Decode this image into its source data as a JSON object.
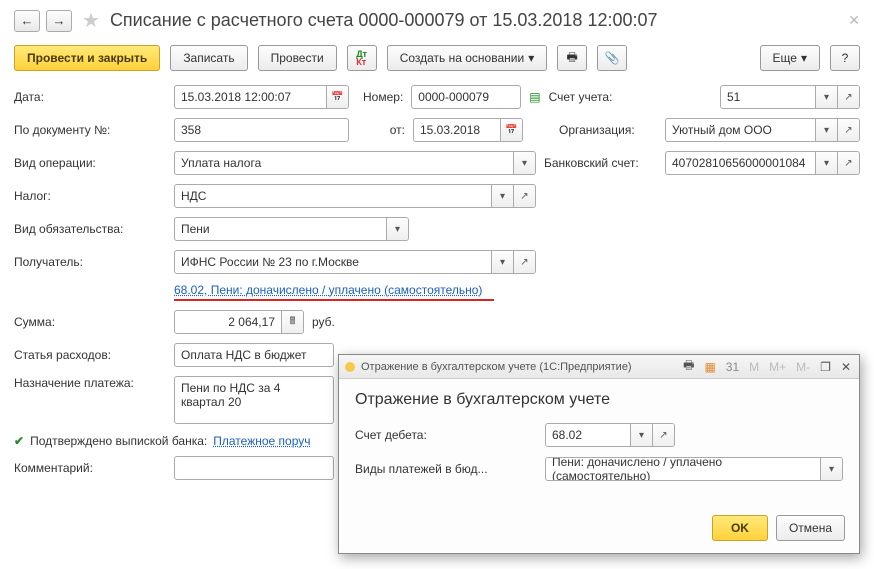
{
  "header": {
    "title": "Списание с расчетного счета 0000-000079 от 15.03.2018 12:00:07"
  },
  "toolbar": {
    "submit_close": "Провести и закрыть",
    "save": "Записать",
    "submit": "Провести",
    "create_based": "Создать на основании",
    "more": "Еще",
    "help": "?"
  },
  "fields": {
    "date_label": "Дата:",
    "date_value": "15.03.2018 12:00:07",
    "number_label": "Номер:",
    "number_value": "0000-000079",
    "account_label": "Счет учета:",
    "account_value": "51",
    "doc_no_label": "По документу №:",
    "doc_no_value": "358",
    "doc_from_label": "от:",
    "doc_from_value": "15.03.2018",
    "org_label": "Организация:",
    "org_value": "Уютный дом ООО",
    "op_type_label": "Вид операции:",
    "op_type_value": "Уплата налога",
    "bank_acc_label": "Банковский счет:",
    "bank_acc_value": "40702810656000001084",
    "tax_label": "Налог:",
    "tax_value": "НДС",
    "obligation_label": "Вид обязательства:",
    "obligation_value": "Пени",
    "recipient_label": "Получатель:",
    "recipient_value": "ИФНС России № 23 по г.Москве",
    "link_text": "68.02, Пени: доначислено / уплачено (самостоятельно)",
    "sum_label": "Сумма:",
    "sum_value": "2 064,17",
    "sum_currency": "руб.",
    "expense_label": "Статья расходов:",
    "expense_value": "Оплата НДС в бюджет",
    "purpose_label": "Назначение платежа:",
    "purpose_value": "Пени по НДС за 4 квартал 20",
    "confirmed_label": "Подтверждено выпиской банка:",
    "payment_order_link": "Платежное поруч",
    "comment_label": "Комментарий:"
  },
  "modal": {
    "window_title": "Отражение в бухгалтерском учете  (1С:Предприятие)",
    "heading": "Отражение в бухгалтерском учете",
    "debit_label": "Счет дебета:",
    "debit_value": "68.02",
    "payment_types_label": "Виды платежей в бюд...",
    "payment_types_value": "Пени: доначислено / уплачено (самостоятельно)",
    "ok": "OK",
    "cancel": "Отмена",
    "tb_m": "M",
    "tb_mplus": "M+",
    "tb_mminus": "M-"
  }
}
